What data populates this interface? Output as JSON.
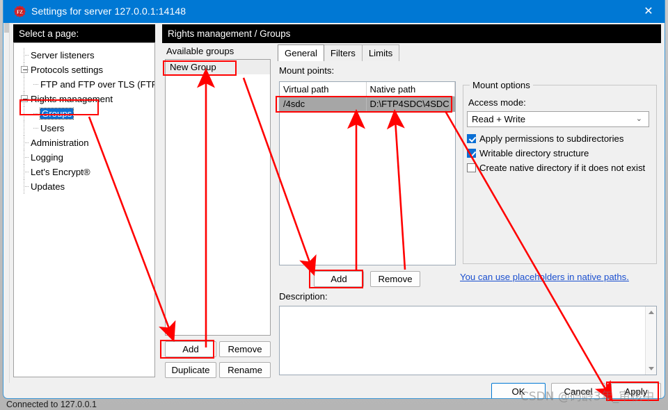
{
  "window": {
    "title": "Settings for server 127.0.0.1:14148",
    "icon": "filezilla-logo-icon",
    "close_label": "✕",
    "accent_color": "#0078d4"
  },
  "headers": {
    "select_page": "Select a page:",
    "breadcrumb": "Rights management / Groups"
  },
  "sidebar": {
    "items": [
      {
        "label": "Server listeners",
        "indent": 0,
        "expander": false,
        "selected": false
      },
      {
        "label": "Protocols settings",
        "indent": 0,
        "expander": true,
        "selected": false
      },
      {
        "label": "FTP and FTP over TLS (FTPS)",
        "indent": 1,
        "expander": false,
        "selected": false
      },
      {
        "label": "Rights management",
        "indent": 0,
        "expander": true,
        "selected": false
      },
      {
        "label": "Groups",
        "indent": 1,
        "expander": false,
        "selected": true
      },
      {
        "label": "Users",
        "indent": 1,
        "expander": false,
        "selected": false
      },
      {
        "label": "Administration",
        "indent": 0,
        "expander": false,
        "selected": false
      },
      {
        "label": "Logging",
        "indent": 0,
        "expander": false,
        "selected": false
      },
      {
        "label": "Let's Encrypt®",
        "indent": 0,
        "expander": false,
        "selected": false
      },
      {
        "label": "Updates",
        "indent": 0,
        "expander": false,
        "selected": false
      }
    ]
  },
  "groups_panel": {
    "heading": "Available groups",
    "items": [
      {
        "label": "New Group",
        "selected": true
      }
    ],
    "buttons": {
      "add": "Add",
      "remove": "Remove",
      "duplicate": "Duplicate",
      "rename": "Rename"
    }
  },
  "tabs": [
    {
      "label": "General",
      "active": true
    },
    {
      "label": "Filters",
      "active": false
    },
    {
      "label": "Limits",
      "active": false
    }
  ],
  "mount_points": {
    "label": "Mount points:",
    "columns": [
      "Virtual path",
      "Native path"
    ],
    "rows": [
      {
        "virtual_path": "/4sdc",
        "native_path": "D:\\FTP4SDC\\4SDC",
        "selected": true
      }
    ],
    "buttons": {
      "add": "Add",
      "remove": "Remove"
    },
    "placeholder_link": "You can use placeholders in native paths."
  },
  "mount_options": {
    "legend": "Mount options",
    "access_mode_label": "Access mode:",
    "access_mode_value": "Read + Write",
    "chevron": "⌄",
    "checkboxes": [
      {
        "label": "Apply permissions to subdirectories",
        "checked": true
      },
      {
        "label": "Writable directory structure",
        "checked": true
      },
      {
        "label": "Create native directory if it does not exist",
        "checked": false
      }
    ]
  },
  "description": {
    "label": "Description:",
    "value": "",
    "scroll_up": "▲",
    "scroll_down": "▼"
  },
  "footer": {
    "ok": "OK",
    "cancel": "Cancel",
    "apply": "Apply"
  },
  "statusbar": {
    "text": "Connected to 127.0.0.1"
  },
  "watermark": {
    "text": "CSDN @码龄3年_审核中"
  },
  "annotations": {
    "color": "#ff0000"
  }
}
